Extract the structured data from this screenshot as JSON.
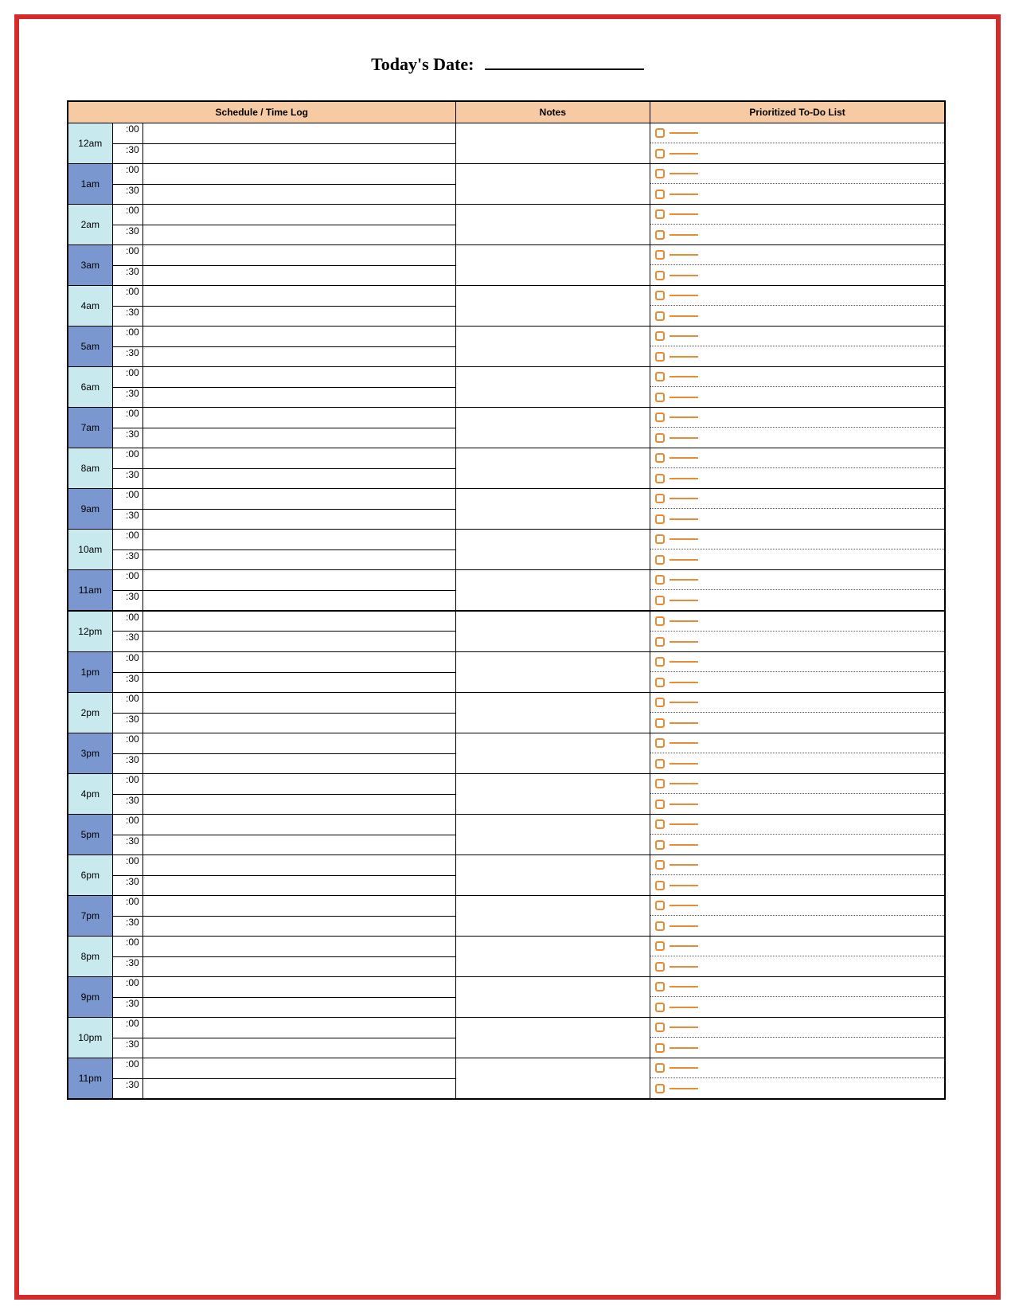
{
  "title": "Today's Date:",
  "date_value": "",
  "headers": {
    "schedule": "Schedule / Time Log",
    "notes": "Notes",
    "todo": "Prioritized To-Do List"
  },
  "minute_labels": {
    "top": ":00",
    "bottom": ":30"
  },
  "hours": [
    {
      "label": "12am",
      "shade": "even"
    },
    {
      "label": "1am",
      "shade": "odd"
    },
    {
      "label": "2am",
      "shade": "even"
    },
    {
      "label": "3am",
      "shade": "odd"
    },
    {
      "label": "4am",
      "shade": "even"
    },
    {
      "label": "5am",
      "shade": "odd"
    },
    {
      "label": "6am",
      "shade": "even"
    },
    {
      "label": "7am",
      "shade": "odd"
    },
    {
      "label": "8am",
      "shade": "even"
    },
    {
      "label": "9am",
      "shade": "odd"
    },
    {
      "label": "10am",
      "shade": "even"
    },
    {
      "label": "11am",
      "shade": "odd"
    },
    {
      "label": "12pm",
      "shade": "even",
      "noon": true
    },
    {
      "label": "1pm",
      "shade": "odd"
    },
    {
      "label": "2pm",
      "shade": "even"
    },
    {
      "label": "3pm",
      "shade": "odd"
    },
    {
      "label": "4pm",
      "shade": "even"
    },
    {
      "label": "5pm",
      "shade": "odd"
    },
    {
      "label": "6pm",
      "shade": "even"
    },
    {
      "label": "7pm",
      "shade": "odd"
    },
    {
      "label": "8pm",
      "shade": "even"
    },
    {
      "label": "9pm",
      "shade": "odd"
    },
    {
      "label": "10pm",
      "shade": "even"
    },
    {
      "label": "11pm",
      "shade": "odd"
    }
  ],
  "colors": {
    "frame": "#d62b2b",
    "header_fill": "#f6caa2",
    "hour_even": "#c8e9ee",
    "hour_odd": "#7b97d0",
    "todo_accent": "#e78b34"
  }
}
